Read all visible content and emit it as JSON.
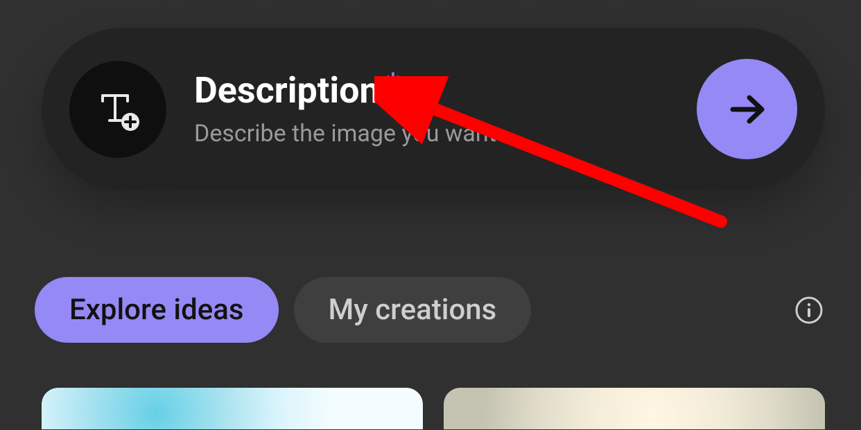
{
  "prompt": {
    "title": "Description",
    "required_mark": "*",
    "placeholder": "Describe the image you want"
  },
  "icons": {
    "type_add": "type-add-icon",
    "submit_arrow": "arrow-right-icon",
    "info": "info-icon"
  },
  "tabs": {
    "active": "Explore ideas",
    "inactive": "My creations"
  },
  "annotation": {
    "color": "#ff0000"
  },
  "colors": {
    "accent": "#9589f6",
    "bg": "#303030",
    "card": "#232323"
  }
}
